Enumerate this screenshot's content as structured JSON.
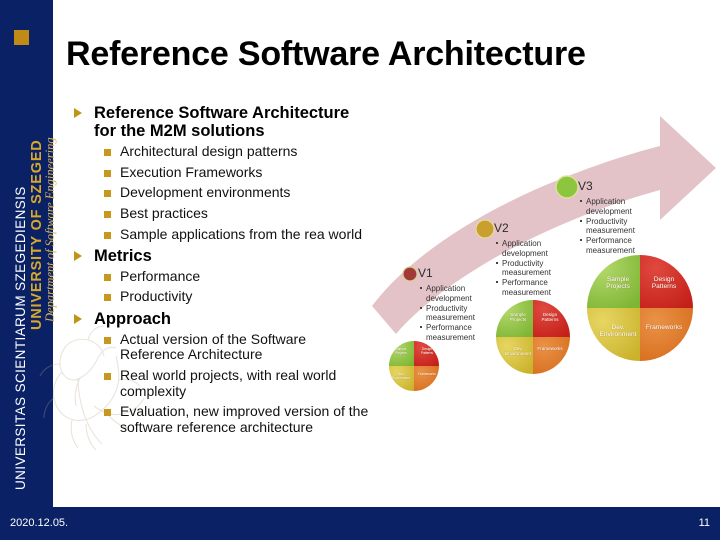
{
  "sidebar": {
    "line_top": "UNIVERSITAS SCIENTIARUM SZEGEDIENSIS",
    "line_mid": "UNIVERSITY OF SZEGED",
    "line_bottom": "Department of Software Engineering",
    "square_color": "#c08a16",
    "background_color": "#0a2166"
  },
  "title": "Reference Software Architecture",
  "body": {
    "sections": [
      {
        "heading": "Reference Software Architecture for the M2M solutions",
        "items": [
          "Architectural design patterns",
          "Execution Frameworks",
          "Development environments",
          "Best practices",
          "Sample applications from the rea world"
        ]
      },
      {
        "heading": "Metrics",
        "items": [
          "Performance",
          "Productivity"
        ]
      },
      {
        "heading": "Approach",
        "items": [
          "Actual version of the Software Reference Architecture",
          "Real world projects, with real world complexity",
          "Evaluation, new improved version of the software reference architecture"
        ]
      }
    ]
  },
  "graphic": {
    "arrow_color": "#e3c3c8",
    "stages": [
      {
        "label": "V1",
        "dot_color": "#a33a3a",
        "bullets": [
          "Application",
          "development",
          "Productivity",
          "measurement",
          "Performance",
          "measurement"
        ]
      },
      {
        "label": "V2",
        "dot_color": "#c9a02e",
        "bullets": [
          "Application",
          "development",
          "Productivity",
          "measurement",
          "Performance",
          "measurement"
        ]
      },
      {
        "label": "V3",
        "dot_color": "#8cc63e",
        "bullets": [
          "Application",
          "development",
          "Productivity",
          "measurement",
          "Performance",
          "measurement"
        ]
      }
    ],
    "pie_slices": [
      {
        "name": "Sample Projects",
        "color": "#92c444"
      },
      {
        "name": "Design Patterns",
        "color": "#d52b24"
      },
      {
        "name": "Dev. Environment",
        "color": "#d9c33a"
      },
      {
        "name": "Frameworks",
        "color": "#e07b2a"
      }
    ]
  },
  "footer": {
    "date": "2020.12.05.",
    "page": "11"
  }
}
